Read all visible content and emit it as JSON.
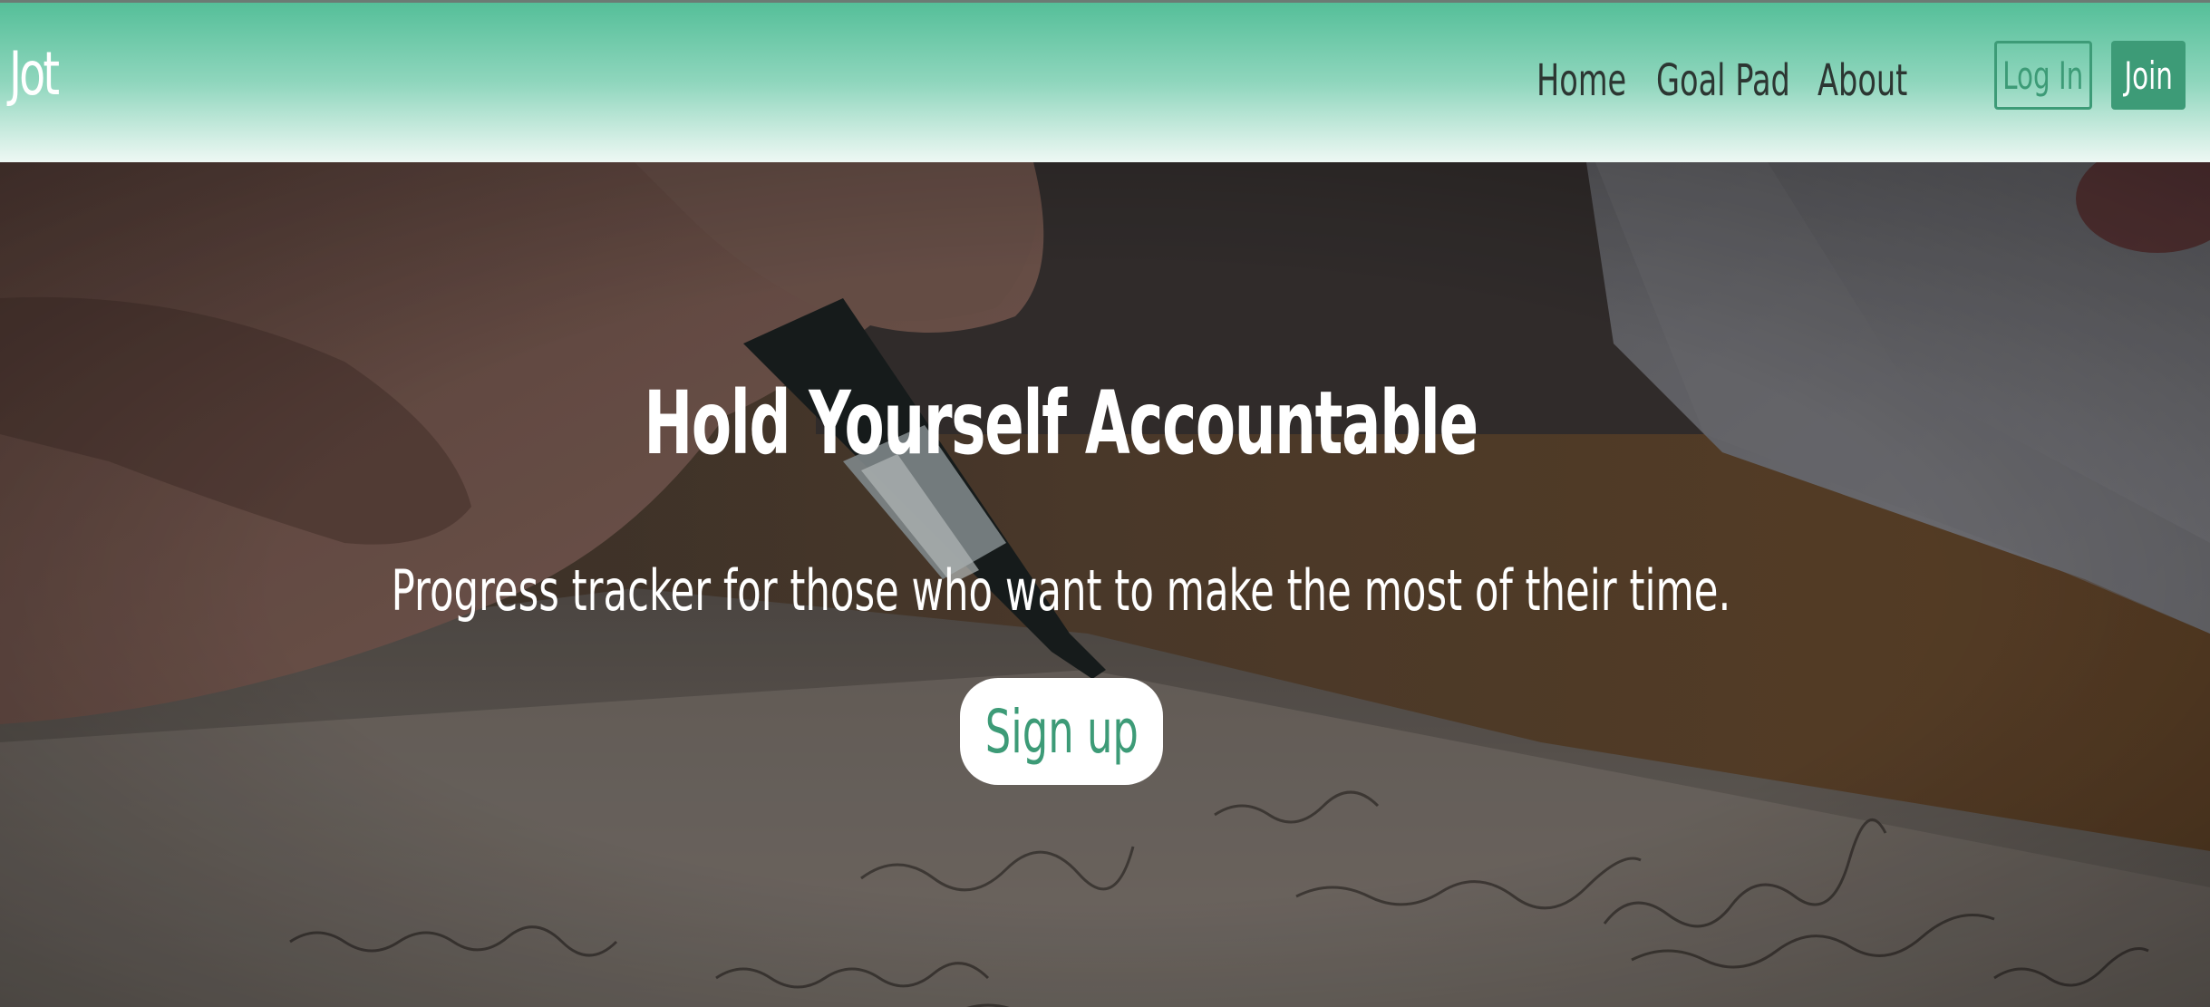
{
  "brand": {
    "name": "Jot"
  },
  "nav": {
    "links": [
      {
        "label": "Home"
      },
      {
        "label": "Goal Pad"
      },
      {
        "label": "About"
      }
    ],
    "login_label": "Log In",
    "join_label": "Join"
  },
  "hero": {
    "title": "Hold Yourself Accountable",
    "subtitle": "Progress tracker for those who want to make the most of their time.",
    "cta_label": "Sign up",
    "background_image": "hand-writing-with-pen-photo"
  },
  "colors": {
    "accent": "#3d9b77",
    "nav_gradient_top": "#55bf99",
    "nav_gradient_bottom": "#eef8f4"
  }
}
